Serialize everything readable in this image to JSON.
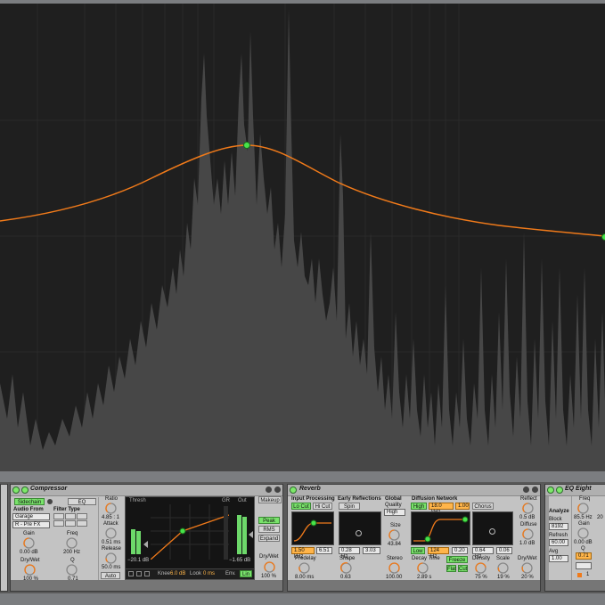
{
  "compressor": {
    "title": "Compressor",
    "sidechain_label": "Sidechain",
    "eq_label": "EQ",
    "audio_from_label": "Audio From",
    "audio_from_value": "Garage",
    "audio_from_sub": "R - Pre FX",
    "filter_type_label": "Filter Type",
    "gain_label": "Gain",
    "gain_value": "0.00 dB",
    "freq_label": "Freq",
    "freq_value": "200 Hz",
    "drywet_label": "Dry/Wet",
    "drywet_value": "100 %",
    "q_label": "Q",
    "q_value": "0.71",
    "ratio_label": "Ratio",
    "ratio_value": "4.85 : 1",
    "attack_label": "Attack",
    "attack_value": "0.51 ms",
    "release_label": "Release",
    "release_value": "50.0 ms",
    "auto_label": "Auto",
    "thresh_label": "Thresh",
    "thresh_value": "−20.1 dB",
    "gr_label": "GR",
    "out_label": "Out",
    "out_value": "−1.65 dB",
    "knee_label": "Knee",
    "knee_value": "6.0 dB",
    "look_label": "Look",
    "look_value": "0 ms",
    "env_label": "Env.",
    "env_value": "Lin",
    "makeup_label": "Makeup",
    "peak_label": "Peak",
    "rms_label": "RMS",
    "expand_label": "Expand",
    "drywet2_label": "Dry/Wet",
    "drywet2_value": "100 %"
  },
  "reverb": {
    "title": "Reverb",
    "input_processing_label": "Input Processing",
    "locut_label": "Lo Cut",
    "hicut_label": "Hi Cut",
    "early_reflections_label": "Early Reflections",
    "spin_label": "Spin",
    "global_label": "Global",
    "quality_label": "Quality",
    "quality_value": "High",
    "size_label": "Size",
    "size_value": "43.84",
    "diffusion_network_label": "Diffusion Network",
    "high_label": "High",
    "high_freq_value": "18.0 kHz",
    "high_scale_value": "1.00",
    "chorus_label": "Chorus",
    "reflect_label": "Reflect",
    "reflect_value": "0.5 dB",
    "diffuse_label": "Diffuse",
    "diffuse_value": "1.0 dB",
    "input_freq_value": "1.50 kHz",
    "input_width_value": "6.51",
    "spin_rate_value": "0.28 Hz",
    "spin_amount_value": "3.03",
    "low_label": "Low",
    "low_freq_value": "124 Hz",
    "low_scale_value": "0.20",
    "chorus_rate_value": "0.64 Hz",
    "chorus_amount_value": "0.06",
    "predelay_label": "Predelay",
    "predelay_value": "8.00 ms",
    "shape_label": "Shape",
    "shape_value": "0.63",
    "stereo_label": "Stereo",
    "stereo_value": "100.00",
    "decay_label": "Decay Time",
    "decay_value": "2.89 s",
    "freeze_label": "Freeze",
    "flat_label": "Flat",
    "cut_label": "Cut",
    "density_label": "Density",
    "density_value": "75 %",
    "scale_label": "Scale",
    "scale_value": "19 %",
    "drywet_label": "Dry/Wet",
    "drywet_value": "20 %"
  },
  "eq_eight": {
    "title": "EQ Eight",
    "analyze_label": "Analyze",
    "block_label": "Block",
    "block_value": "8192",
    "refresh_label": "Refresh",
    "refresh_value": "60.00",
    "avg_label": "Avg",
    "avg_value": "1.00",
    "freq_label": "Freq",
    "freq_value": "85.5 Hz",
    "gain_label": "Gain",
    "gain_value": "0.00 dB",
    "q_label": "Q",
    "q_value": "0.71",
    "band_number": "1",
    "freq2_partial": "20"
  },
  "colors": {
    "curve": "#f07a1a",
    "node": "#47e34a",
    "spectrum": "#4a4a4a",
    "background": "#1e1e1e",
    "active_button": "#79e36b",
    "value_field": "#ffb54a"
  }
}
